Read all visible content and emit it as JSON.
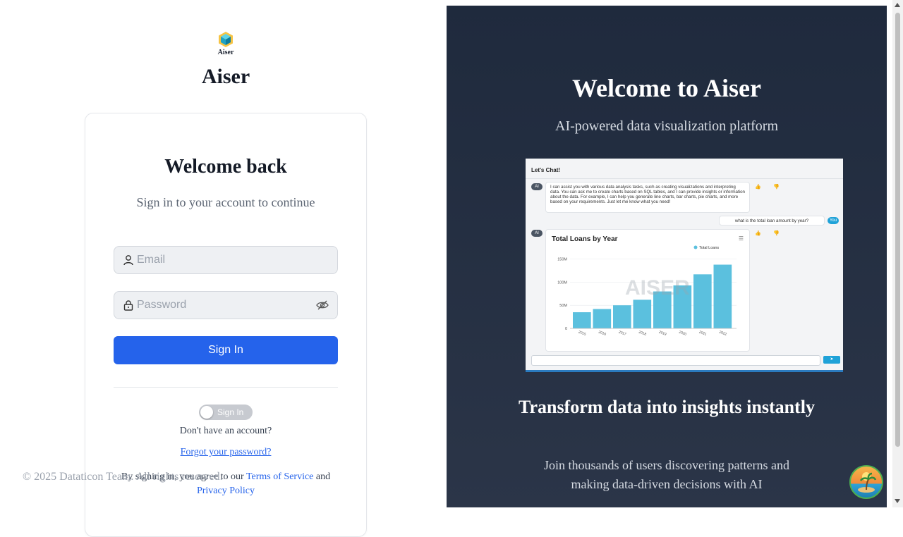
{
  "left": {
    "logo_text": "Aiser",
    "brand": "Aiser",
    "card": {
      "title": "Welcome back",
      "subtitle": "Sign in to your account to continue",
      "email_placeholder": "Email",
      "password_placeholder": "Password",
      "signin_button": "Sign In",
      "toggle_label": "Sign In",
      "no_account": "Don't have an account?",
      "forgot": "Forgot your password?",
      "terms_prefix": "By signing in, you agree to our",
      "terms_link": "Terms of Service",
      "terms_and": "and",
      "privacy_link": "Privacy Policy"
    },
    "copyright": "© 2025 Dataticon Team. All rights reserved."
  },
  "right": {
    "title": "Welcome to Aiser",
    "subtitle": "AI-powered data visualization platform",
    "preview": {
      "header": "Let's Chat!",
      "ai_label": "AI",
      "you_label": "You",
      "ai_message": "I can assist you with various data analysis tasks, such as creating visualizations and interpreting data. You can ask me to create charts based on SQL tables, and I can provide insights or information about the data. For example, I can help you generate line charts, bar charts, pie charts, and more based on your requirements. Just let me know what you need!",
      "user_message": "what is the total loan amount by year?",
      "watermark": "AISER"
    },
    "headline": "Transform data into insights instantly",
    "description": "Join thousands of users discovering patterns and making data-driven decisions with AI"
  },
  "chart_data": {
    "type": "bar",
    "title": "Total Loans by Year",
    "categories": [
      "2015",
      "2016",
      "2017",
      "2018",
      "2019",
      "2020",
      "2021",
      "2022"
    ],
    "series": [
      {
        "name": "Total Loans",
        "values": [
          35000000,
          42000000,
          50000000,
          62000000,
          80000000,
          93000000,
          117000000,
          138000000
        ]
      }
    ],
    "ylim": [
      0,
      180000000
    ],
    "yticks": [
      0,
      50000000,
      100000000,
      150000000
    ],
    "ytick_labels": [
      "0",
      "50M",
      "100M",
      "150M"
    ],
    "legend": "top-right",
    "grid": true
  },
  "colors": {
    "primary": "#2563eb",
    "panel_dark": "#1f2a3d",
    "bar": "#5bc0de"
  }
}
